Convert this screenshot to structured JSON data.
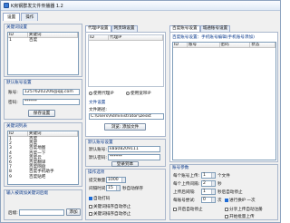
{
  "window": {
    "title": "K房钢群发文件传播器 1.2"
  },
  "tabs": [
    {
      "label": "设置"
    },
    {
      "label": "操作"
    }
  ],
  "keyword_panel": {
    "title": "关键词设置",
    "subtitle": "关键词设置",
    "columns": [
      "ID",
      "关键词"
    ],
    "rows": [
      {
        "id": "1",
        "kw": "百度"
      }
    ]
  },
  "account_panel": {
    "title": "默认账号设置",
    "account_label": "账号:",
    "account_value": "12576202206@qq.com",
    "password_label": "密码:",
    "password_value": "******",
    "save_button": "保存设置"
  },
  "keyword_list": {
    "title": "关键词列表",
    "columns": [
      "ID",
      "关键词"
    ],
    "rows": [
      {
        "id": "1",
        "kw": "百度"
      },
      {
        "id": "2",
        "kw": "百度"
      },
      {
        "id": "3",
        "kw": "百度地图"
      },
      {
        "id": "4",
        "kw": "百度一下"
      },
      {
        "id": "5",
        "kw": "百度云"
      },
      {
        "id": "6",
        "kw": "百度翻译"
      },
      {
        "id": "7",
        "kw": "百度网盘"
      },
      {
        "id": "8",
        "kw": "百度手机助手"
      },
      {
        "id": "9",
        "kw": "百度贴吧"
      }
    ]
  },
  "pick_panel": {
    "title": "输入被调加关键词后缀",
    "label": "后缀:",
    "value": "",
    "add_button": "添加"
  },
  "proxy_panel": {
    "tabs": [
      "代理IP设置",
      "网页缺设置"
    ],
    "columns": [
      "ID",
      "代理IP"
    ],
    "use_proxy": "使用代理IP",
    "use_web_ip": "使用宽带IP",
    "file_title": "文件设置",
    "file_label": "文件路径:",
    "file_value": "C:\\Users\\Administrator\\Deskt",
    "browse_button": "浏览: 添加文件"
  },
  "default_account": {
    "title": "默认账号设置",
    "account_label": "默认账号:",
    "account_value": "k8a08209111",
    "password_label": "默认密码:",
    "password_value": "******",
    "login_button": "登录到本"
  },
  "operation": {
    "title": "操作选项",
    "count_label": "提交数量:",
    "count_value": "1000",
    "interval_label": "间隔时间:",
    "interval_value": "15",
    "interval_unit": "秒自动保存",
    "auto_login": "自动打码",
    "opt1": "关键词排序自动停止",
    "opt2": "关键词排序自动停止"
  },
  "right_panel": {
    "tabs": [
      "百度账号设置",
      "城通账号设置"
    ],
    "subtitle": "百度账号设置：手机账号编辑(手机账号添加)",
    "columns": [
      "ID",
      "账号",
      "密码",
      "状态"
    ]
  },
  "account_params": {
    "title": "账号参数",
    "every_upload_label": "每个账号上传:",
    "every_upload_value": "1",
    "every_upload_unit": "个文件",
    "upload_gap_label": "每个上传间隔:",
    "upload_gap_value": "2",
    "upload_gap_unit": "秒",
    "upload_rate_label": "上传后间隔:",
    "upload_rate_value": "1",
    "upload_rate_unit": "秒后自动停止",
    "retries_label": "每账号尝试:",
    "retries_value": "0",
    "retries_unit": "次",
    "proxy_label": "进行换IP 一次",
    "auto_close": "开启自动停止",
    "register": "分享上传自动注册",
    "batch": "开始批量上传"
  }
}
